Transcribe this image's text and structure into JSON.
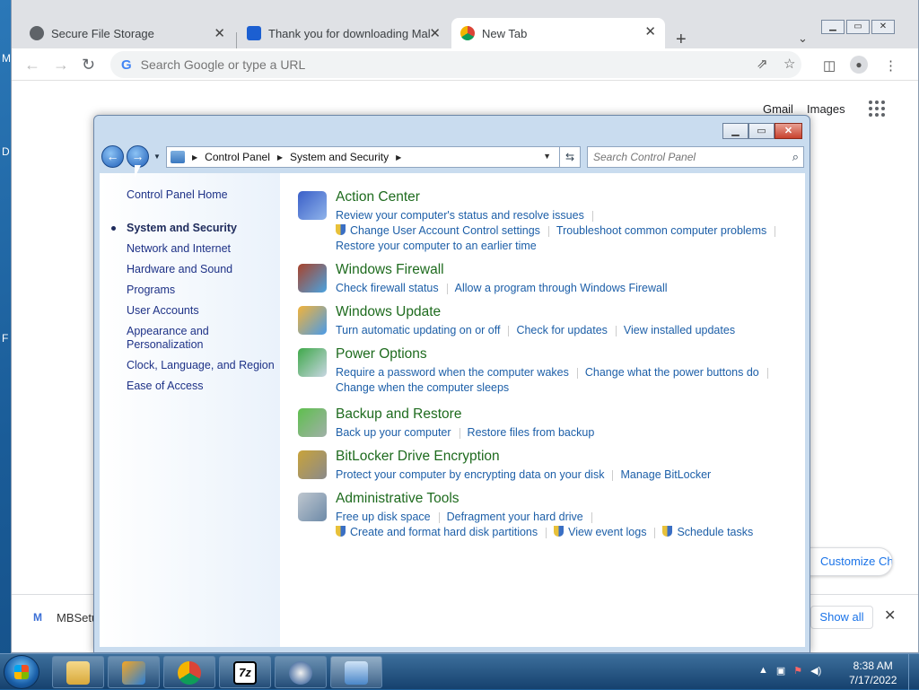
{
  "desktop": {
    "side_labels": [
      "M",
      "D",
      "F"
    ]
  },
  "chrome": {
    "tabs": [
      {
        "title": "Secure File Storage",
        "favicon": "globe-icon"
      },
      {
        "title": "Thank you for downloading Malv",
        "favicon": "malwarebytes-icon"
      },
      {
        "title": "New Tab",
        "favicon": "chrome-icon"
      }
    ],
    "new_tab": "+",
    "omnibox_placeholder": "Search Google or type a URL",
    "ntp": {
      "gmail": "Gmail",
      "images": "Images",
      "customize": "Customize Chrome"
    },
    "download": {
      "file": "MBSetup",
      "show_all": "Show all",
      "close": "✕"
    }
  },
  "cp": {
    "breadcrumb": [
      "Control Panel",
      "System and Security"
    ],
    "search_placeholder": "Search Control Panel",
    "nav": [
      "Control Panel Home",
      "System and Security",
      "Network and Internet",
      "Hardware and Sound",
      "Programs",
      "User Accounts",
      "Appearance and Personalization",
      "Clock, Language, and Region",
      "Ease of Access"
    ],
    "selected_nav": "System and Security",
    "categories": [
      {
        "title": "Action Center",
        "links": [
          [
            "Review your computer's status and resolve issues"
          ],
          [
            "Change User Account Control settings",
            "Troubleshoot common computer problems"
          ],
          [
            "Restore your computer to an earlier time"
          ]
        ]
      },
      {
        "title": "Windows Firewall",
        "links": [
          [
            "Check firewall status",
            "Allow a program through Windows Firewall"
          ]
        ]
      },
      {
        "title": "Windows Update",
        "links": [
          [
            "Turn automatic updating on or off",
            "Check for updates",
            "View installed updates"
          ]
        ]
      },
      {
        "title": "Power Options",
        "links": [
          [
            "Require a password when the computer wakes",
            "Change what the power buttons do"
          ],
          [
            "Change when the computer sleeps"
          ]
        ]
      },
      {
        "title": "Backup and Restore",
        "links": [
          [
            "Back up your computer",
            "Restore files from backup"
          ]
        ]
      },
      {
        "title": "BitLocker Drive Encryption",
        "links": [
          [
            "Protect your computer by encrypting data on your disk",
            "Manage BitLocker"
          ]
        ]
      },
      {
        "title": "Administrative Tools",
        "links": [
          [
            "Free up disk space",
            "Defragment your hard drive"
          ],
          [
            "Create and format hard disk partitions",
            "View event logs",
            "Schedule tasks"
          ]
        ]
      }
    ]
  },
  "taskbar": {
    "clock_time": "8:38 AM",
    "clock_date": "7/17/2022"
  }
}
